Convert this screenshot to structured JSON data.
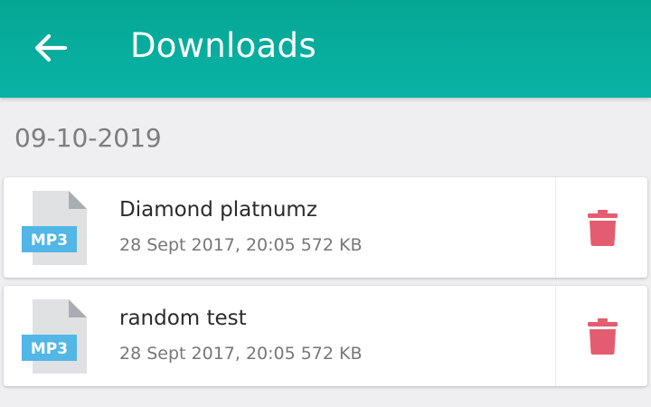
{
  "header": {
    "title": "Downloads",
    "back_icon": "arrow-left-icon",
    "background_color": "#07ab9c"
  },
  "sections": [
    {
      "date": "09-10-2019",
      "items": [
        {
          "name": "Diamond platnumz",
          "date": "28 Sept 2017, 20:05",
          "size": "572 KB",
          "type_label": "MP3",
          "file_icon": "mp3-file-icon",
          "delete_icon": "trash-icon"
        },
        {
          "name": "random test",
          "date": "28 Sept 2017, 20:05",
          "size": "572 KB",
          "type_label": "MP3",
          "file_icon": "mp3-file-icon",
          "delete_icon": "trash-icon"
        }
      ]
    }
  ],
  "colors": {
    "accent": "#07ab9c",
    "delete": "#e45c70",
    "mp3_badge": "#52b6e6",
    "file_page": "#e0e1e3"
  }
}
